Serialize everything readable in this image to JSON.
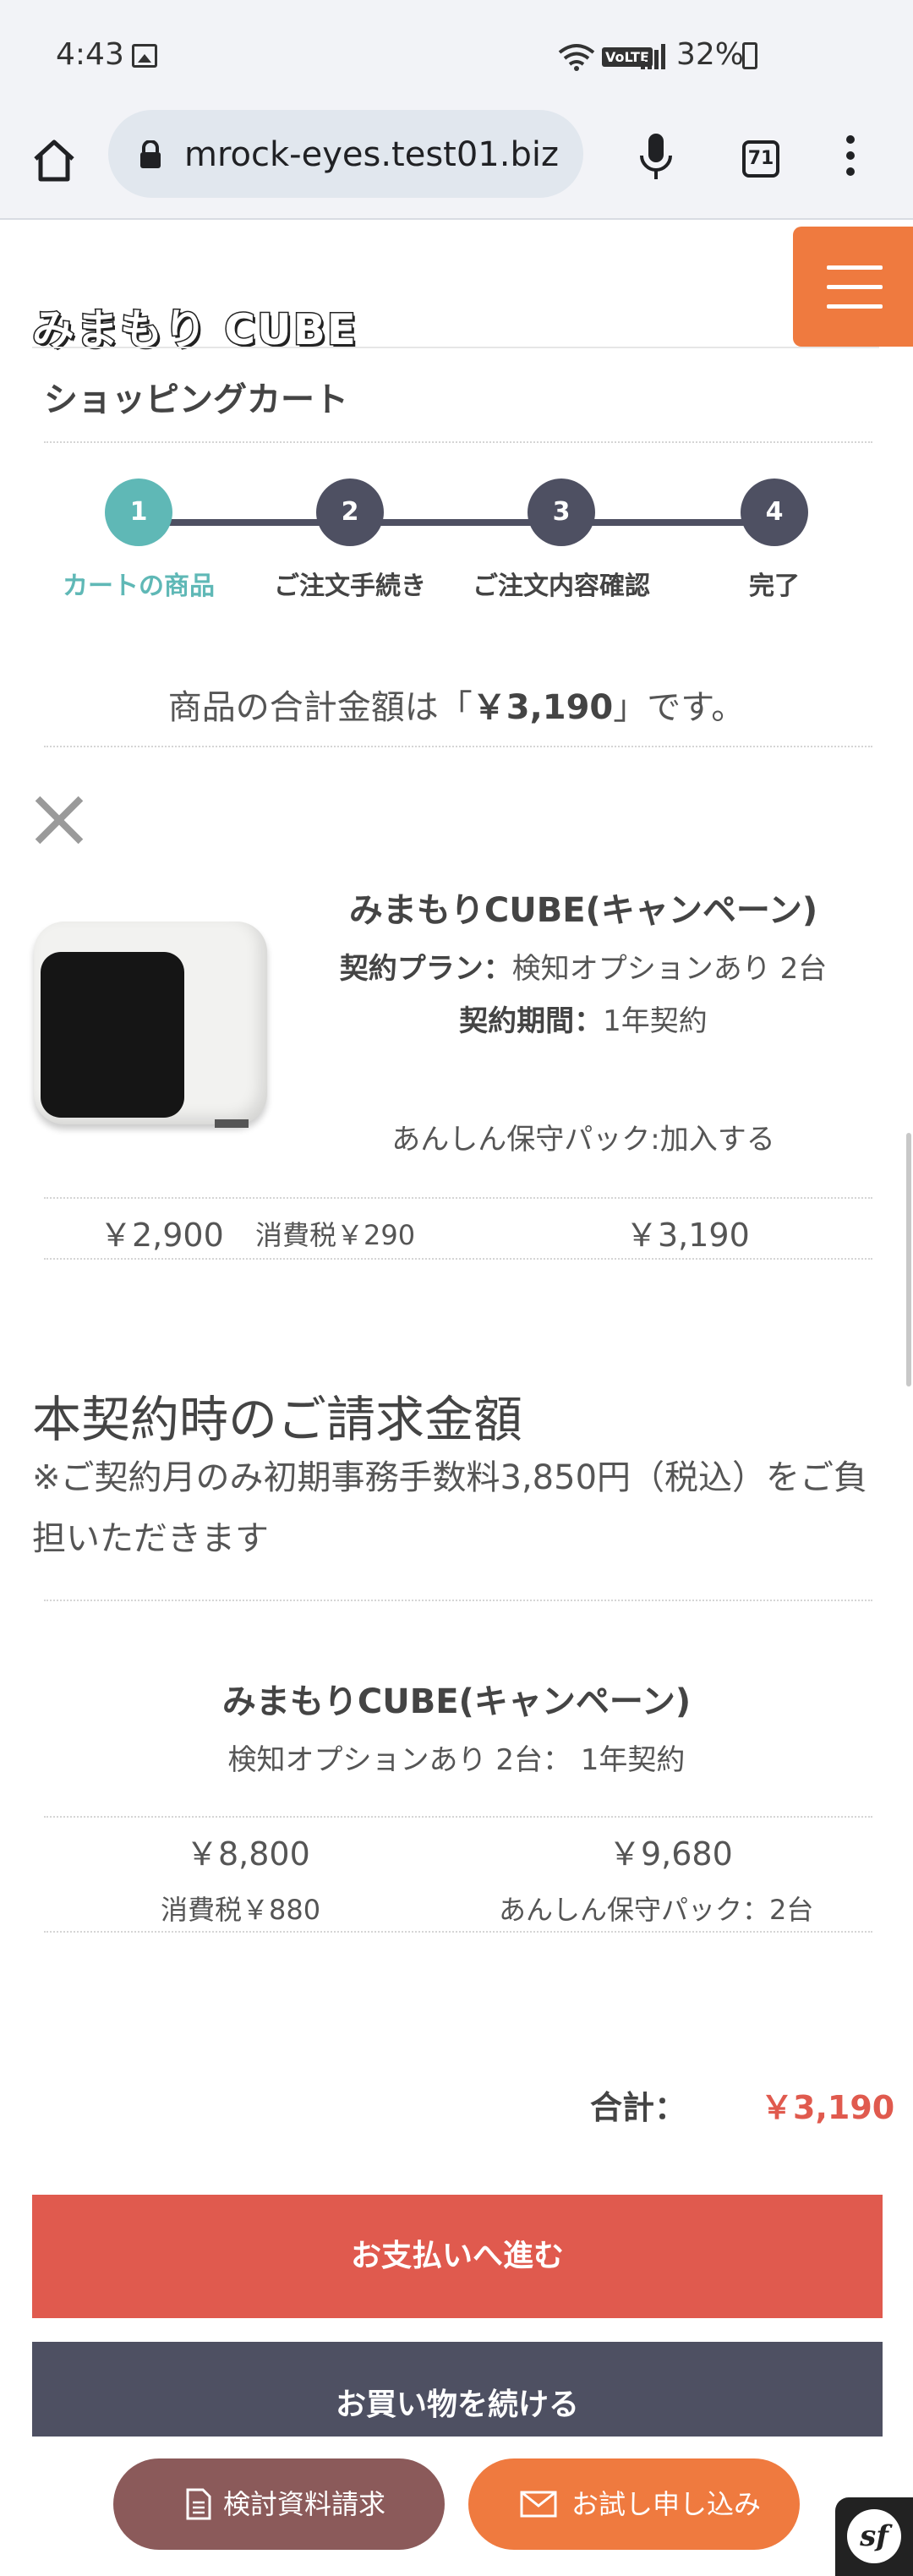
{
  "status_bar": {
    "time": "4:43",
    "signal": "VoLTE",
    "battery": "32%"
  },
  "browser": {
    "url": "mrock-eyes.test01.biz",
    "tab_count": "71"
  },
  "site": {
    "logo": "みまもり CUBE"
  },
  "page": {
    "title": "ショッピングカート",
    "steps": [
      {
        "number": "1",
        "label": "カートの商品"
      },
      {
        "number": "2",
        "label": "ご注文手続き"
      },
      {
        "number": "3",
        "label": "ご注文内容確認"
      },
      {
        "number": "4",
        "label": "完了"
      }
    ],
    "total_prefix": "商品の合計金額は「",
    "total_amount": "￥3,190",
    "total_suffix": "」です。"
  },
  "cart_item": {
    "name": "みまもりCUBE(キャンペーン)",
    "plan_label": "契約プラン：",
    "plan_value": "検知オプションあり 2台",
    "period_label": "契約期間：",
    "period_value": "1年契約",
    "option": "あんしん保守パック:加入する",
    "price": "￥2,900",
    "tax": "消費税￥290",
    "subtotal": "￥3,190"
  },
  "billing": {
    "heading": "本契約時のご請求金額",
    "note": "※ご契約月のみ初期事務手数料3,850円（税込）をご負担いただきます",
    "name": "みまもりCUBE(キャンペーン)",
    "detail": "検知オプションあり 2台： 1年契約",
    "price": "￥8,800",
    "tax": "消費税￥880",
    "total": "￥9,680",
    "pack": "あんしん保守パック：2台"
  },
  "summary": {
    "label": "合計：",
    "value": "￥3,190"
  },
  "buttons": {
    "pay": "お支払いへ進む",
    "continue": "お買い物を続ける"
  },
  "floating": {
    "docs": "検討資料請求",
    "trial": "お試し申し込み",
    "badge": "sf"
  },
  "colors": {
    "accent_orange": "#ef7a3f",
    "teal": "#5fb8b6",
    "navy": "#4e5062",
    "red": "#e05a4e"
  }
}
